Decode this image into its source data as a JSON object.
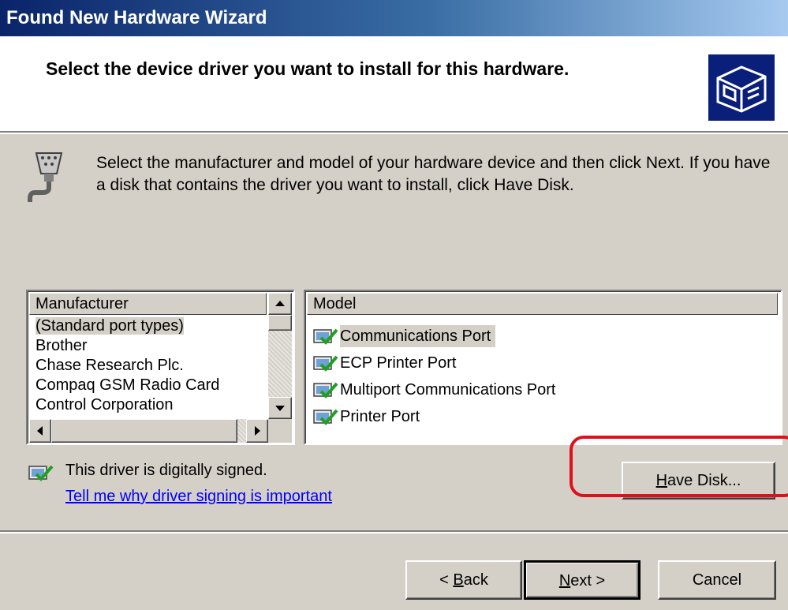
{
  "window": {
    "title": "Found New Hardware Wizard"
  },
  "header": {
    "title": "Select the device driver you want to install for this hardware.",
    "icon": "hardware-wizard-icon"
  },
  "instruction": "Select the manufacturer and model of your hardware device and then click Next. If you have a disk that contains the driver you want to install, click Have Disk.",
  "manufacturer": {
    "header": "Manufacturer",
    "items": [
      "(Standard port types)",
      "Brother",
      "Chase Research Plc.",
      "Compaq GSM Radio Card",
      "Control Corporation"
    ],
    "selected": "(Standard port types)"
  },
  "model": {
    "header": "Model",
    "items": [
      "Communications Port",
      "ECP Printer Port",
      "Multiport Communications Port",
      "Printer Port"
    ],
    "selected": "Communications Port"
  },
  "signing": {
    "status": "This driver is digitally signed.",
    "link": "Tell me why driver signing is important"
  },
  "buttons": {
    "have_disk": {
      "mnemonic": "H",
      "rest": "ave Disk..."
    },
    "back": {
      "prefix": "< ",
      "mnemonic": "B",
      "rest": "ack"
    },
    "next": {
      "mnemonic": "N",
      "rest": "ext >"
    },
    "cancel": "Cancel"
  },
  "colors": {
    "highlight": "#e0101a",
    "titlebar": "#0a246a",
    "link": "#0000ff"
  }
}
